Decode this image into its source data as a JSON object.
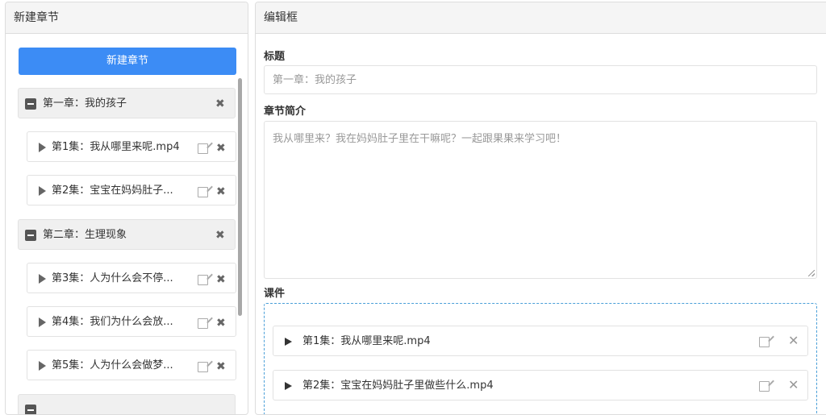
{
  "left_panel": {
    "title": "新建章节",
    "new_button": "新建章节",
    "chapters": [
      {
        "label": "第一章：我的孩子"
      },
      {
        "label": "第二章：生理现象"
      }
    ],
    "episodes": [
      {
        "label": "第1集：我从哪里来呢.mp4"
      },
      {
        "label": "第2集：宝宝在妈妈肚子..."
      },
      {
        "label": "第3集：人为什么会不停..."
      },
      {
        "label": "第4集：我们为什么会放..."
      },
      {
        "label": "第5集：人为什么会做梦..."
      }
    ]
  },
  "right_panel": {
    "title": "编辑框",
    "title_label": "标题",
    "title_placeholder": "第一章：我的孩子",
    "intro_label": "章节简介",
    "intro_placeholder": "我从哪里来？我在妈妈肚子里在干嘛呢？一起跟果果来学习吧！",
    "courseware_label": "课件",
    "files": [
      {
        "label": "第1集：我从哪里来呢.mp4"
      },
      {
        "label": "第2集：宝宝在妈妈肚子里做些什么.mp4"
      }
    ]
  },
  "colors": {
    "primary_button": "#3c8cf5",
    "dropzone_border": "#4a9fd8"
  },
  "icons": [
    "minus-square-icon",
    "close-icon",
    "play-icon",
    "edit-icon",
    "resize-handle-icon"
  ]
}
